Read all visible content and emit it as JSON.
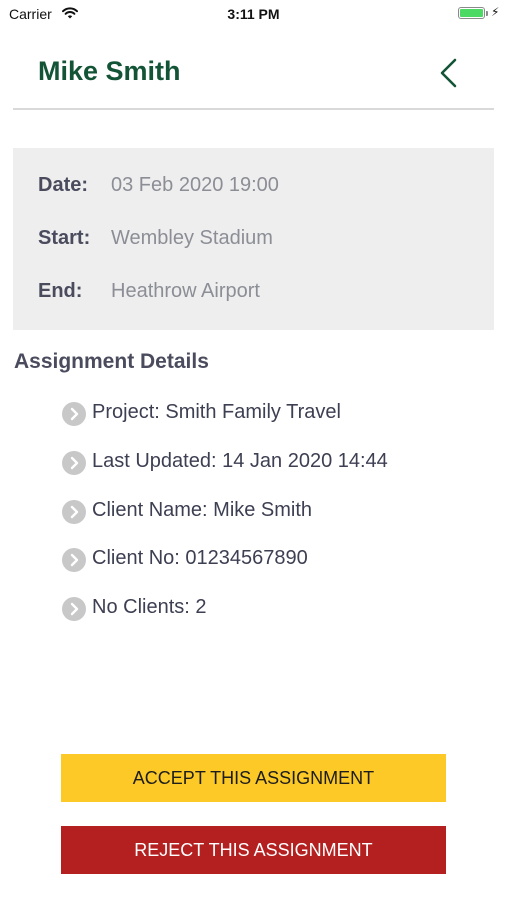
{
  "status_bar": {
    "carrier": "Carrier",
    "time": "3:11 PM",
    "icons": [
      "wifi-icon",
      "battery-icon",
      "charging-icon"
    ],
    "battery_level": 1.0
  },
  "header": {
    "title": "Mike Smith",
    "back_icon": "chevron-left-icon"
  },
  "trip": {
    "date_label": "Date:",
    "date_value": "03 Feb 2020 19:00",
    "start_label": "Start:",
    "start_value": "Wembley Stadium",
    "end_label": "End:",
    "end_value": "Heathrow Airport"
  },
  "details": {
    "title": "Assignment Details",
    "item_icon": "chevron-right-circle-icon",
    "items": [
      "Project: Smith Family Travel",
      "Last Updated: 14 Jan 2020 14:44",
      "Client Name: Mike Smith",
      "Client No: 01234567890",
      "No Clients: 2"
    ]
  },
  "actions": {
    "accept_label": "ACCEPT THIS ASSIGNMENT",
    "reject_label": "REJECT THIS ASSIGNMENT"
  },
  "colors": {
    "brand_green": "#135436",
    "accept_yellow": "#fcc926",
    "reject_red": "#b42020",
    "card_bg": "#eeeeee"
  }
}
